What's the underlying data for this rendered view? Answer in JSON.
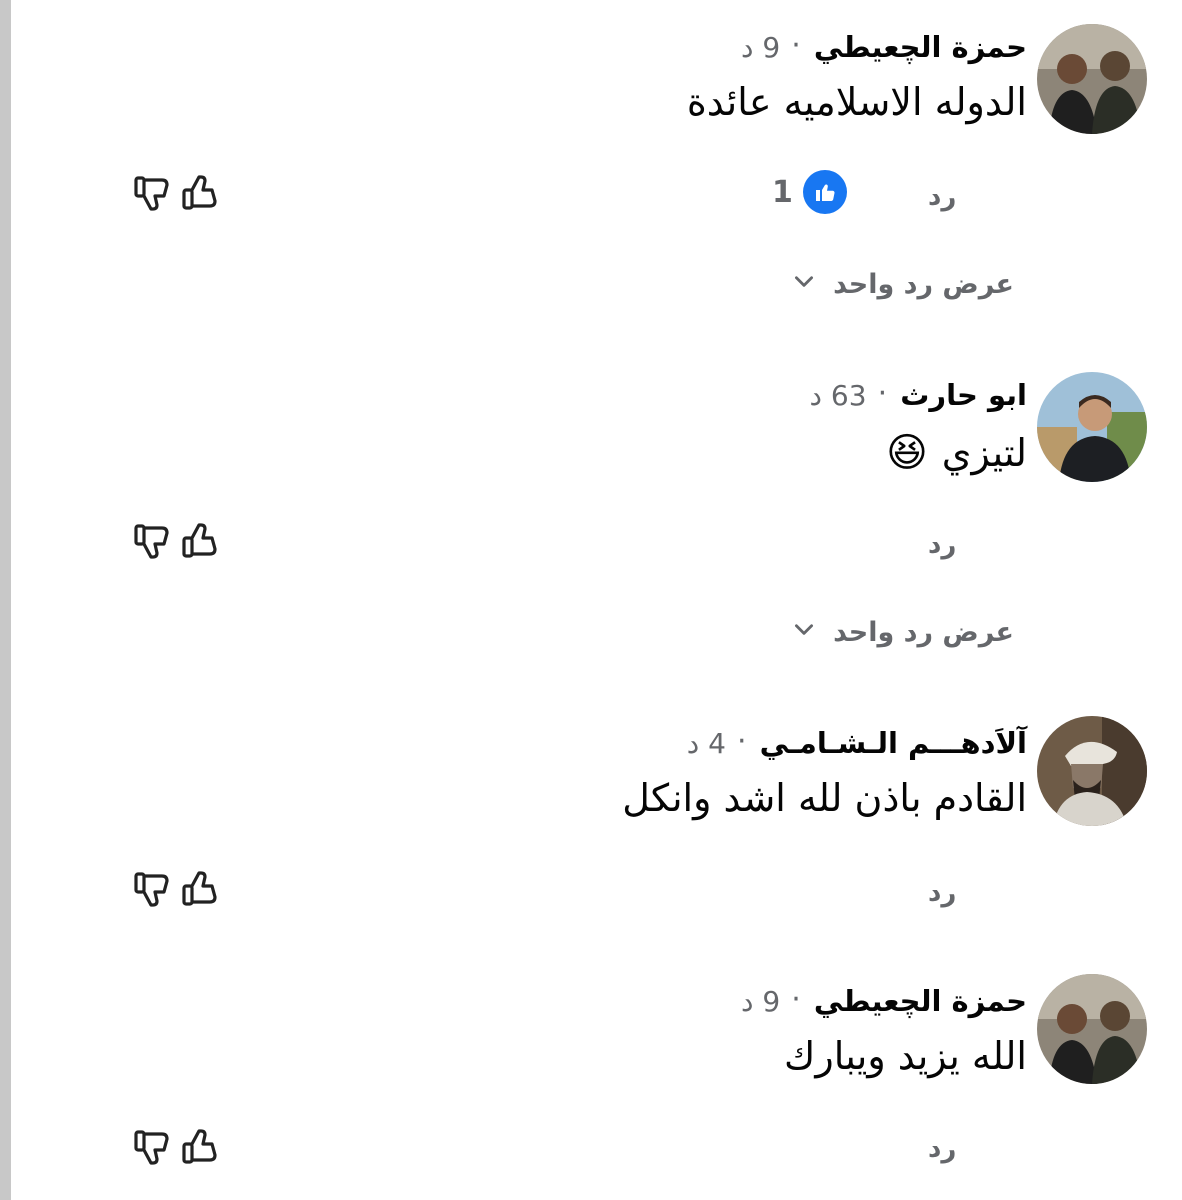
{
  "comments": [
    {
      "name": "حمزة الچعيطي",
      "time": "9 د",
      "text": "الدوله الاسلاميه عائدة",
      "emoji": "",
      "reply": "رد",
      "likes": "1",
      "view_replies": "عرض رد واحد"
    },
    {
      "name": "ابو حارث",
      "time": "63 د",
      "text": "لتيزي",
      "emoji": "😆",
      "reply": "رد",
      "likes": "",
      "view_replies": "عرض رد واحد"
    },
    {
      "name": "آلاَدهـــم الـشـامـي",
      "time": "4 د",
      "text": "القادم باذن لله اشد وانكل",
      "emoji": "",
      "reply": "رد",
      "likes": "",
      "view_replies": ""
    },
    {
      "name": "حمزة الچعيطي",
      "time": "9 د",
      "text": "الله يزيد ويبارك",
      "emoji": "",
      "reply": "رد",
      "likes": "",
      "view_replies": ""
    }
  ],
  "separator": "·",
  "icons": {
    "like_badge": "thumbs-up-icon",
    "upvote": "thumb-up-outline-icon",
    "downvote": "thumb-down-outline-icon",
    "expand": "chevron-down-icon"
  },
  "colors": {
    "accent": "#1877f2",
    "secondary_text": "#65676b",
    "primary_text": "#050505"
  }
}
